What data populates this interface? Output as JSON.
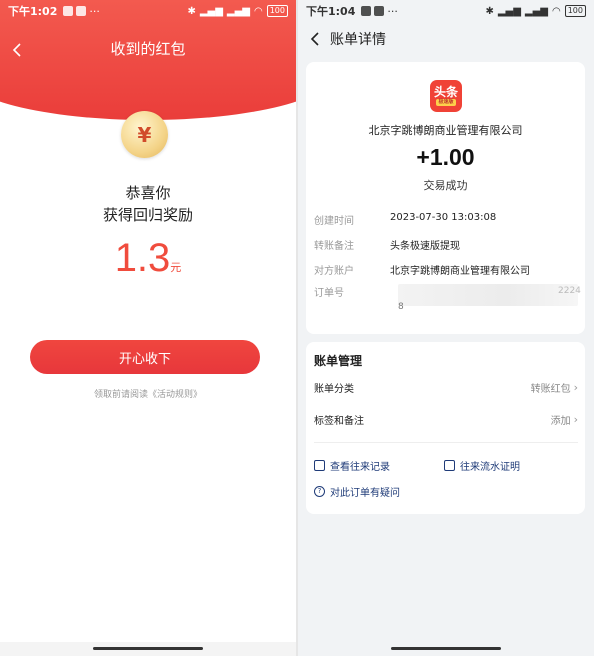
{
  "left": {
    "status_time": "下午1:02",
    "status_dots": "···",
    "battery": "100",
    "title": "收到的红包",
    "coin_symbol": "¥",
    "congrats_line1": "恭喜你",
    "congrats_line2": "获得回归奖励",
    "amount": "1.3",
    "amount_unit": "元",
    "claim_button": "开心收下",
    "rules_text": "领取前请阅读《活动规则》"
  },
  "right": {
    "status_time": "下午1:04",
    "status_dots": "···",
    "battery": "100",
    "title": "账单详情",
    "logo_text": "头条",
    "logo_sub": "极速版",
    "company": "北京字跳博朗商业管理有限公司",
    "amount": "+1.00",
    "trade_status": "交易成功",
    "details": [
      {
        "key": "创建时间",
        "value": "2023-07-30 13:03:08"
      },
      {
        "key": "转账备注",
        "value": "头条极速版提现"
      },
      {
        "key": "对方账户",
        "value": "北京字跳博朗商业管理有限公司"
      },
      {
        "key": "订单号",
        "value": ""
      }
    ],
    "order_tail": "2224",
    "order_line2": "8",
    "manage_title": "账单管理",
    "category_label": "账单分类",
    "category_value": "转账红包",
    "tags_label": "标签和备注",
    "tags_value": "添加",
    "link_records": "查看往来记录",
    "link_statement": "往来流水证明",
    "link_question": "对此订单有疑问"
  },
  "colors": {
    "red": "#ea3d3a",
    "amount_red": "#f04c3d",
    "link_blue": "#1f3b78"
  }
}
